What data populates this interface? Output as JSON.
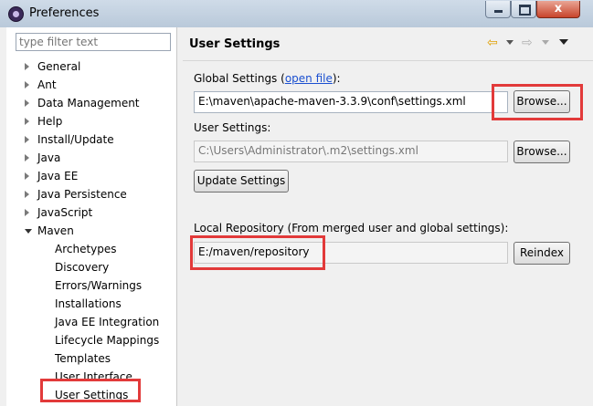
{
  "window": {
    "title": "Preferences",
    "close_glyph": "x"
  },
  "filter": {
    "placeholder": "type filter text"
  },
  "tree": {
    "top": [
      "General",
      "Ant",
      "Data Management",
      "Help",
      "Install/Update",
      "Java",
      "Java EE",
      "Java Persistence",
      "JavaScript",
      "Maven"
    ],
    "maven_children": [
      "Archetypes",
      "Discovery",
      "Errors/Warnings",
      "Installations",
      "Java EE Integration",
      "Lifecycle Mappings",
      "Templates",
      "User Interface",
      "User Settings"
    ],
    "selected": "User Settings"
  },
  "page": {
    "title": "User Settings",
    "global_label": "Global Settings (",
    "open_file_link": "open file",
    "global_label_end": "):",
    "global_value": "E:\\maven\\apache-maven-3.3.9\\conf\\settings.xml",
    "browse_label": "Browse...",
    "user_label": "User Settings:",
    "user_value": "C:\\Users\\Administrator\\.m2\\settings.xml",
    "update_label": "Update Settings",
    "local_repo_label": "Local Repository (From merged user and global settings):",
    "local_repo_value": "E:/maven/repository",
    "reindex_label": "Reindex"
  },
  "icons": {
    "back": "back-arrow-icon",
    "forward": "forward-arrow-icon",
    "menu": "view-menu-icon"
  },
  "colors": {
    "highlight": "#e23a3a",
    "link": "#1a4fd0"
  }
}
